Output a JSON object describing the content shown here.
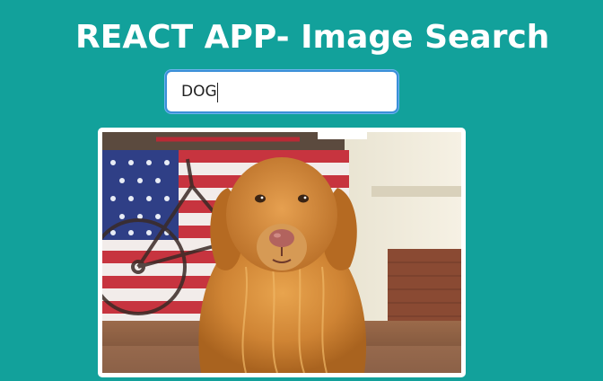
{
  "header": {
    "title": "REACT APP- Image Search"
  },
  "search": {
    "value": "DOG",
    "placeholder": ""
  },
  "results": [
    {
      "subject": "golden-retriever-photo",
      "accent": "#d9923a"
    }
  ],
  "colors": {
    "background": "#12a19b",
    "input_focus": "#3a8fd8",
    "card": "#ffffff"
  }
}
